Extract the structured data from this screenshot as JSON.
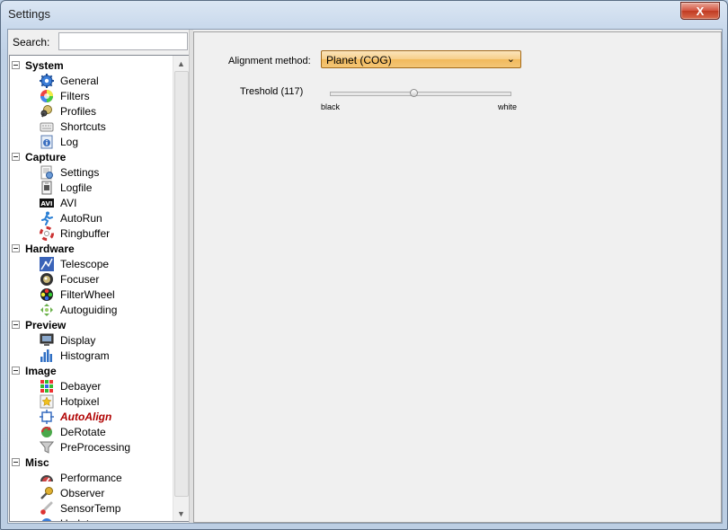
{
  "window": {
    "title": "Settings",
    "close_label": "X"
  },
  "search": {
    "label": "Search:",
    "value": "",
    "placeholder": ""
  },
  "tree": [
    {
      "category": "System",
      "items": [
        {
          "label": "General",
          "icon": "gear-icon"
        },
        {
          "label": "Filters",
          "icon": "color-wheel-icon"
        },
        {
          "label": "Profiles",
          "icon": "profiles-icon"
        },
        {
          "label": "Shortcuts",
          "icon": "keyboard-icon"
        },
        {
          "label": "Log",
          "icon": "info-log-icon"
        }
      ]
    },
    {
      "category": "Capture",
      "items": [
        {
          "label": "Settings",
          "icon": "document-settings-icon"
        },
        {
          "label": "Logfile",
          "icon": "logfile-icon"
        },
        {
          "label": "AVI",
          "icon": "avi-icon"
        },
        {
          "label": "AutoRun",
          "icon": "running-man-icon"
        },
        {
          "label": "Ringbuffer",
          "icon": "lifebuoy-icon"
        }
      ]
    },
    {
      "category": "Hardware",
      "items": [
        {
          "label": "Telescope",
          "icon": "telescope-icon"
        },
        {
          "label": "Focuser",
          "icon": "focuser-icon"
        },
        {
          "label": "FilterWheel",
          "icon": "filterwheel-icon"
        },
        {
          "label": "Autoguiding",
          "icon": "autoguiding-icon"
        }
      ]
    },
    {
      "category": "Preview",
      "items": [
        {
          "label": "Display",
          "icon": "monitor-icon"
        },
        {
          "label": "Histogram",
          "icon": "histogram-icon"
        }
      ]
    },
    {
      "category": "Image",
      "items": [
        {
          "label": "Debayer",
          "icon": "bayer-grid-icon"
        },
        {
          "label": "Hotpixel",
          "icon": "hotpixel-icon"
        },
        {
          "label": "AutoAlign",
          "icon": "autoalign-icon",
          "selected": true
        },
        {
          "label": "DeRotate",
          "icon": "derotate-icon"
        },
        {
          "label": "PreProcessing",
          "icon": "funnel-icon"
        }
      ]
    },
    {
      "category": "Misc",
      "items": [
        {
          "label": "Performance",
          "icon": "gauge-icon"
        },
        {
          "label": "Observer",
          "icon": "microphone-icon"
        },
        {
          "label": "SensorTemp",
          "icon": "thermometer-icon"
        },
        {
          "label": "Updates",
          "icon": "updates-icon"
        }
      ]
    }
  ],
  "panel": {
    "alignment_label": "Alignment method:",
    "alignment_value": "Planet (COG)",
    "threshold_label": "Treshold (117)",
    "threshold_value": 117,
    "threshold_min": 0,
    "threshold_max": 255,
    "min_label": "black",
    "max_label": "white"
  },
  "colors": {
    "selected_item": "#b00000",
    "dropdown_orange": "#f7cf8a"
  }
}
